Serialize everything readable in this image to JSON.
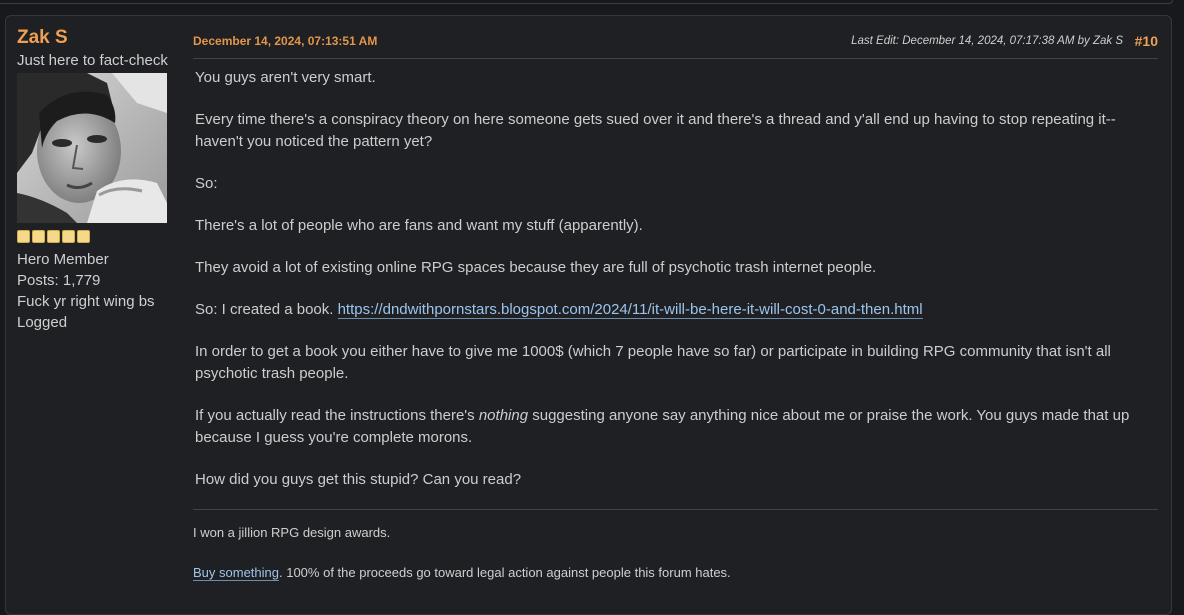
{
  "poster": {
    "name": "Zak S",
    "custom_title": "Just here to fact-check",
    "stars": 5,
    "rank": "Hero Member",
    "posts": "Posts: 1,779",
    "personal_text": "Fuck yr right wing bs",
    "logged": "Logged"
  },
  "header": {
    "date": "December 14, 2024, 07:13:51 AM",
    "last_edit": "Last Edit: December 14, 2024, 07:17:38 AM by Zak S",
    "post_number": "#10"
  },
  "body": {
    "p1": "You guys aren't very smart.",
    "p2": "Every time there's a conspiracy theory on here someone gets sued over it and there's a thread and y'all end up having to stop repeating it--haven't you noticed the pattern yet?",
    "p3": "So:",
    "p4": "There's a lot of people who are fans and want my stuff (apparently).",
    "p5": "They avoid a lot of existing online RPG spaces because they are full of psychotic trash internet people.",
    "p6_prefix": "So: I created a book. ",
    "p6_link": "https://dndwithpornstars.blogspot.com/2024/11/it-will-be-here-it-will-cost-0-and-then.html",
    "p7": "In order to get a book you either have to give me 1000$ (which 7 people have so far) or participate in building RPG community that isn't all psychotic trash people.",
    "p8_prefix": "If you actually read the instructions there's ",
    "p8_emphasis": "nothing",
    "p8_suffix": " suggesting anyone say anything nice about me or praise the work. You guys made that up because I guess you're complete morons.",
    "p9": "How did you guys get this stupid? Can you read?"
  },
  "signature": {
    "line1": "I won a jillion RPG design awards.",
    "link": "Buy something",
    "line2_suffix": ". 100% of the proceeds go toward legal action against people this forum hates."
  },
  "colors": {
    "accent": "#f0a052",
    "link": "#9cc4ec",
    "background": "#17191d",
    "panel": "#1f2024",
    "star": "#f5d88a"
  }
}
